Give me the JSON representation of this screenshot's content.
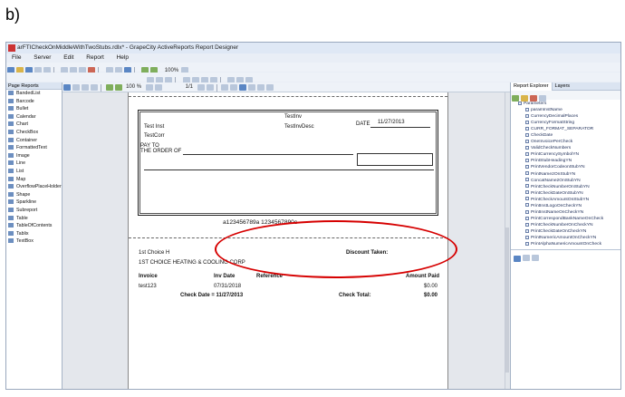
{
  "figure_label": "b)",
  "window": {
    "title": "arFTICheckOnMiddleWithTwoStubs.rdlx* - GrapeCity ActiveReports Report Designer"
  },
  "menu": [
    "File",
    "Server",
    "Edit",
    "Report",
    "Help"
  ],
  "toolbar1": {
    "zoom": "100%"
  },
  "doc_toolbar": {
    "zoom": "100 %",
    "page": "1/1"
  },
  "left_panel": {
    "title": "Page Reports",
    "items": [
      "BandedList",
      "Barcode",
      "Bullet",
      "Calendar",
      "Chart",
      "CheckBox",
      "Container",
      "FormattedText",
      "Image",
      "Line",
      "List",
      "Map",
      "OverflowPlaceHolder",
      "Shape",
      "Sparkline",
      "Subreport",
      "Table",
      "TableOfContents",
      "Tablix",
      "TextBox"
    ]
  },
  "right_panel": {
    "tabs": [
      "Report Explorer",
      "Layers"
    ],
    "root": "Parameters",
    "params": [
      "paramInstName",
      "CurrencyDecimalPlaces",
      "CurrencyFormatString",
      "CURR_FORMAT_SEPARATOR",
      "CheckDate",
      "OneInvoicePerCheck",
      "ValidCheckNumbers",
      "PrintCurrencySymbolYN",
      "PrintStubHeadingYN",
      "PrintVendorCodeonStubYN",
      "PrintName2OnStubYN",
      "ConcatName2OnStubYN",
      "PrintCheckNumberOnStubYN",
      "PrintCheckDateOnStubYN",
      "PrintCheckAmountOnStubYN",
      "PrintInstLogoOnCheckYN",
      "PrintInstNameOnCheckYN",
      "PrintCorrespondBankNameOnCheck",
      "PrintCheckNumberOnCheckYN",
      "PrintCheckDateOnCheckYN",
      "PrintNumericAmountOnCheckYN",
      "PrintAlphaNumericAmountOnCheck"
    ]
  },
  "check": {
    "test_inv": "TestInv",
    "test_inv_desc": "TestInvDesc",
    "test_inst": "Test Inst",
    "test_corr": "TestCorr",
    "date_label": "DATE",
    "date_value": "11/27/2013",
    "pay_to_line1": "PAY TO",
    "pay_to_line2": "THE ORDER OF",
    "micr": "a123456789a 1234567890c"
  },
  "stub": {
    "vendor_short": "1st Choice H",
    "vendor_full": "1ST CHOICE HEATING & COOLING CORP",
    "discount_label": "Discount Taken:",
    "headers": {
      "invoice": "Invoice",
      "inv_date": "Inv Date",
      "reference": "Reference",
      "amount_paid": "Amount Paid"
    },
    "row": {
      "invoice": "test123",
      "inv_date": "07/31/2018",
      "amount": "$0.00"
    },
    "check_date_label": "Check Date = 11/27/2013",
    "check_total_label": "Check Total:",
    "check_total_value": "$0.00"
  },
  "annotation_color": "#d60000"
}
